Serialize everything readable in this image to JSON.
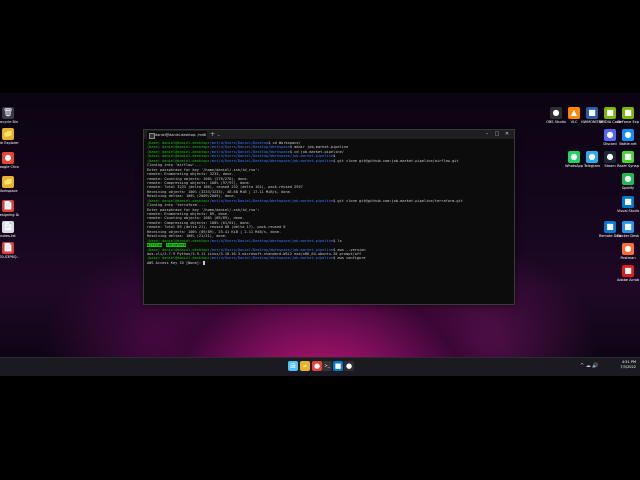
{
  "desktop_icons_left": [
    {
      "name": "recycle-bin-icon",
      "label": "Recycle Bin",
      "glyph": "🗑",
      "color": "#3a3a4a"
    },
    {
      "name": "file-explorer-icon",
      "label": "File Explorer",
      "glyph": "📁",
      "color": "#e8b22a"
    },
    {
      "name": "chrome-icon",
      "label": "Google Chrome",
      "glyph": "●",
      "color": "#ea4335"
    },
    {
      "name": "workspace-folder-icon",
      "label": "Workspace",
      "glyph": "📁",
      "color": "#e8b22a"
    },
    {
      "name": "pdf-file-icon",
      "label": "Designing Data Intens...",
      "glyph": "📄",
      "color": "#e53935"
    },
    {
      "name": "text-file-icon",
      "label": "notes.txt",
      "glyph": "📄",
      "color": "#dddddd"
    },
    {
      "name": "pdf-file-icon-2",
      "label": "500-S3P6Q...",
      "glyph": "📄",
      "color": "#e53935"
    }
  ],
  "desktop_icons_right": [
    {
      "name": "obs-icon",
      "label": "OBS Studio",
      "glyph": "●",
      "color": "#302e31"
    },
    {
      "name": "vlc-icon",
      "label": "VLC",
      "glyph": "▲",
      "color": "#ff8800"
    },
    {
      "name": "hwmonitor-icon",
      "label": "HWMONITOR",
      "glyph": "■",
      "color": "#2a5caa"
    },
    {
      "name": "nvidia-icon",
      "label": "NVIDIA Control Panel",
      "glyph": "■",
      "color": "#76b900"
    },
    {
      "name": "geforce-icon",
      "label": "GeForce Experience",
      "glyph": "■",
      "color": "#76b900"
    },
    {
      "name": "whatsapp-icon",
      "label": "WhatsApp",
      "glyph": "●",
      "color": "#25d366"
    },
    {
      "name": "telegram-icon",
      "label": "Telegram",
      "glyph": "●",
      "color": "#2aabee"
    },
    {
      "name": "discord-icon",
      "label": "Discord",
      "glyph": "●",
      "color": "#5865f2"
    },
    {
      "name": "steam-icon",
      "label": "Steam",
      "glyph": "●",
      "color": "#1b2838"
    },
    {
      "name": "battlenet-icon",
      "label": "Battle.net",
      "glyph": "●",
      "color": "#148eff"
    },
    {
      "name": "spotify-icon",
      "label": "Spotify",
      "glyph": "●",
      "color": "#1db954"
    },
    {
      "name": "razer-icon",
      "label": "Razer Synapse",
      "glyph": "■",
      "color": "#44d62c"
    },
    {
      "name": "vscode-icon",
      "label": "Visual Studio Code",
      "glyph": "■",
      "color": "#007acc"
    },
    {
      "name": "remote-desktop-icon",
      "label": "Remote Desktop Conne...",
      "glyph": "■",
      "color": "#0078d4"
    },
    {
      "name": "docker-icon",
      "label": "Docker Desktop",
      "glyph": "■",
      "color": "#2496ed"
    },
    {
      "name": "postman-icon",
      "label": "Postman",
      "glyph": "●",
      "color": "#ff6c37"
    },
    {
      "name": "acrobat-icon",
      "label": "Adobe Acrobat DC",
      "glyph": "■",
      "color": "#e21b1b"
    }
  ],
  "terminal": {
    "tab_title": "daniel@daniel-desktop: /mnt",
    "plus": "+",
    "chevron": "⌄",
    "minimize": "–",
    "maximize": "□",
    "close": "✕",
    "lines": [
      {
        "user": "(base) daniel@daniel-desktop",
        "path": "/mnt/d/Users/Daniel/Desktop",
        "cmd": "$ cd Workspace/"
      },
      {
        "user": "(base) daniel@daniel-desktop",
        "path": "/mnt/d/Users/Daniel/Desktop/Workspace",
        "cmd": "$ mkdir job-market-pipeline"
      },
      {
        "user": "(base) daniel@daniel-desktop",
        "path": "/mnt/d/Users/Daniel/Desktop/Workspace",
        "cmd": "$ cd job-market-pipeline/"
      },
      {
        "user": "(base) daniel@daniel-desktop",
        "path": "/mnt/d/Users/Daniel/Desktop/Workspace/job-market-pipeline",
        "cmd": "$"
      },
      {
        "user": "(base) daniel@daniel-desktop",
        "path": "/mnt/d/Users/Daniel/Desktop/Workspace/job-market-pipeline",
        "cmd": "$ git clone git@github.com:job-market-pipeline/airflow.git"
      },
      {
        "text": "Cloning into 'airflow'..."
      },
      {
        "text": "Enter passphrase for key '/home/daniel/.ssh/id_rsa':"
      },
      {
        "text": "remote: Enumerating objects: 3233, done."
      },
      {
        "text": "remote: Counting objects: 100% (276/276), done."
      },
      {
        "text": "remote: Compressing objects: 100% (97/97), done."
      },
      {
        "text": "remote: Total 3233 (delta 186), reused 232 (delta 161), pack-reused 2957"
      },
      {
        "text": "Receiving objects: 100% (3233/3233), 48.68 MiB | 17.11 MiB/s, done."
      },
      {
        "text": "Resolving deltas: 100% (2009/2009), done."
      },
      {
        "user": "(base) daniel@daniel-desktop",
        "path": "/mnt/d/Users/Daniel/Desktop/Workspace/job-market-pipeline",
        "cmd": "$ git clone git@github.com:job-market-pipeline/terraform.git"
      },
      {
        "text": "Cloning into 'terraform'..."
      },
      {
        "text": "Enter passphrase for key '/home/daniel/.ssh/id_rsa':"
      },
      {
        "text": "remote: Enumerating objects: 89, done."
      },
      {
        "text": "remote: Counting objects: 100% (89/89), done."
      },
      {
        "text": "remote: Compressing objects: 100% (61/61), done."
      },
      {
        "text": "remote: Total 89 (delta 21), reused 68 (delta 17), pack-reused 0"
      },
      {
        "text": "Receiving objects: 100% (89/89), 25.41 KiB | 2.11 MiB/s, done."
      },
      {
        "text": "Resolving deltas: 100% (21/21), done."
      },
      {
        "user": "(base) daniel@daniel-desktop",
        "path": "/mnt/d/Users/Daniel/Desktop/Workspace/job-market-pipeline",
        "cmd": "$ ls"
      },
      {
        "ls": [
          "airflow",
          "terraform"
        ]
      },
      {
        "user": "(base) daniel@daniel-desktop",
        "path": "/mnt/d/Users/Daniel/Desktop/Workspace/job-market-pipeline",
        "cmd": "$ aws --version"
      },
      {
        "text": "aws-cli/2.7.9 Python/3.9.11 Linux/5.10.16.3-microsoft-standard-WSL2 exe/x86_64.ubuntu.20 prompt/off"
      },
      {
        "user": "(base) daniel@daniel-desktop",
        "path": "/mnt/d/Users/Daniel/Desktop/Workspace/job-market-pipeline",
        "cmd": "$ aws configure"
      },
      {
        "text": "AWS Access Key ID [None]:",
        "cursor": true
      }
    ]
  },
  "taskbar": {
    "icons": [
      {
        "name": "start-icon",
        "glyph": "⊞",
        "color": "#4cc2ff"
      },
      {
        "name": "taskbar-explorer-icon",
        "glyph": "📁",
        "color": "#e8b22a"
      },
      {
        "name": "taskbar-chrome-icon",
        "glyph": "●",
        "color": "#ea4335"
      },
      {
        "name": "taskbar-terminal-icon",
        "glyph": ">_",
        "color": "#333333"
      },
      {
        "name": "taskbar-vscode-icon",
        "glyph": "■",
        "color": "#007acc"
      },
      {
        "name": "taskbar-obs-icon",
        "glyph": "●",
        "color": "#302e31"
      }
    ],
    "tray": "^  ☁  🔊",
    "time": "4:51 PM",
    "date": "7/3/2022"
  }
}
